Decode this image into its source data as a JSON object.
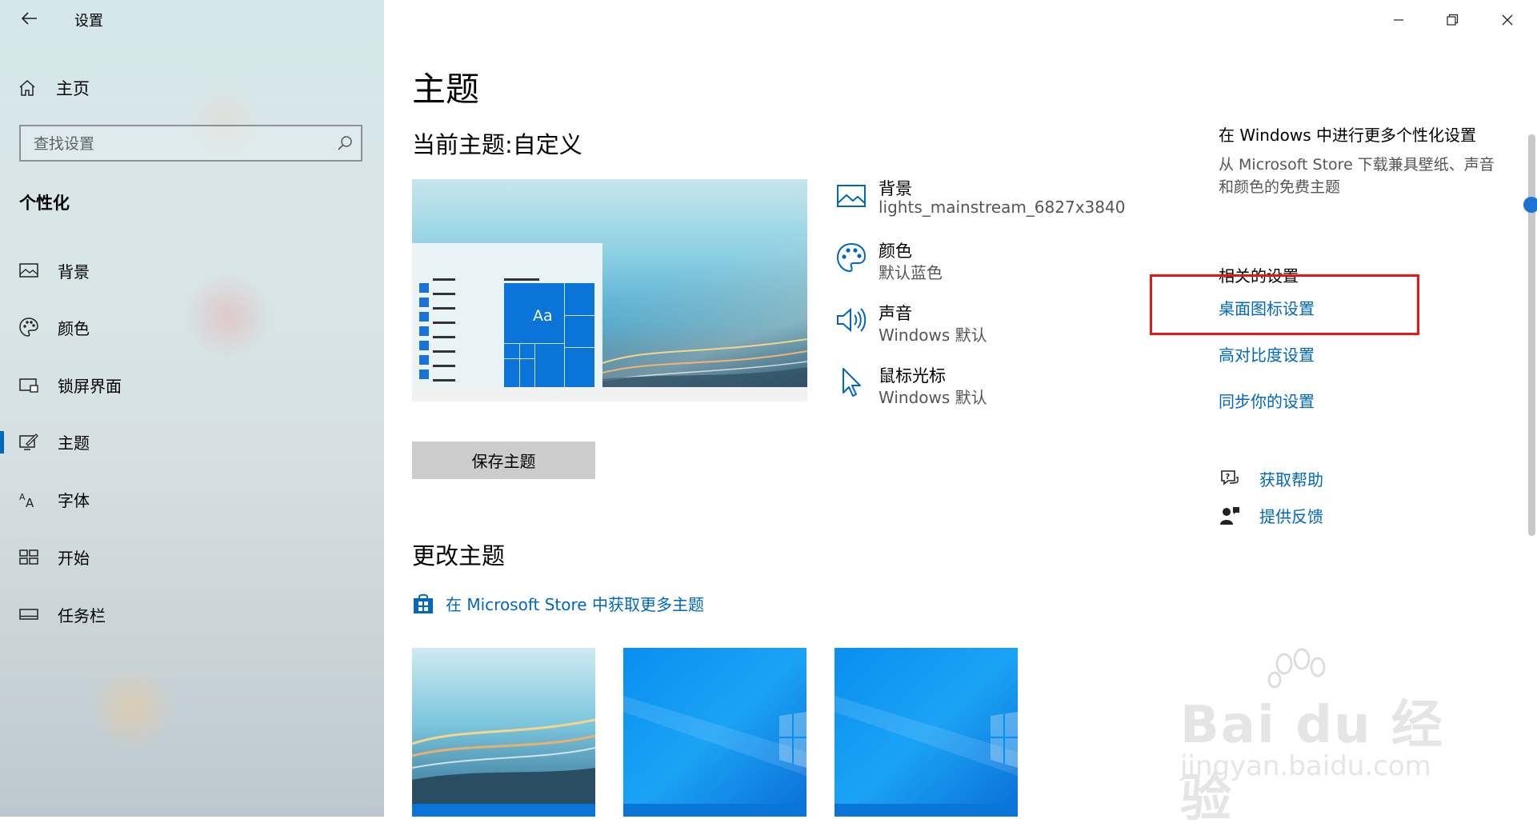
{
  "window": {
    "title": "设置",
    "controls": [
      "minimize",
      "restore",
      "close"
    ]
  },
  "sidebar": {
    "home_label": "主页",
    "search_placeholder": "查找设置",
    "section_title": "个性化",
    "items": [
      {
        "label": "背景",
        "icon": "image-icon"
      },
      {
        "label": "颜色",
        "icon": "palette-icon"
      },
      {
        "label": "锁屏界面",
        "icon": "lock-screen-icon"
      },
      {
        "label": "主题",
        "icon": "theme-icon",
        "active": true
      },
      {
        "label": "字体",
        "icon": "font-icon"
      },
      {
        "label": "开始",
        "icon": "start-icon"
      },
      {
        "label": "任务栏",
        "icon": "taskbar-icon"
      }
    ]
  },
  "main": {
    "page_title": "主题",
    "current_theme": "当前主题:自定义",
    "preview_tile_text": "Aa",
    "properties": [
      {
        "name": "背景",
        "value": "lights_mainstream_6827x3840",
        "icon": "image-icon"
      },
      {
        "name": "颜色",
        "value": "默认蓝色",
        "icon": "palette-icon"
      },
      {
        "name": "声音",
        "value": "Windows 默认",
        "icon": "speaker-icon"
      },
      {
        "name": "鼠标光标",
        "value": "Windows 默认",
        "icon": "cursor-icon"
      }
    ],
    "save_button": "保存主题",
    "change_title": "更改主题",
    "store_link": "在 Microsoft Store 中获取更多主题"
  },
  "right_panel": {
    "heading": "在 Windows 中进行更多个性化设置",
    "description": "从 Microsoft Store 下载兼具壁纸、声音和颜色的免费主题",
    "related_title": "相关的设置",
    "links": [
      "桌面图标设置",
      "高对比度设置",
      "同步你的设置"
    ],
    "help": "获取帮助",
    "feedback": "提供反馈"
  },
  "watermark": {
    "brand": "Bai du 经验",
    "url": "jingyan.baidu.com"
  },
  "colors": {
    "accent": "#0067c0",
    "highlight": "#e81616"
  }
}
